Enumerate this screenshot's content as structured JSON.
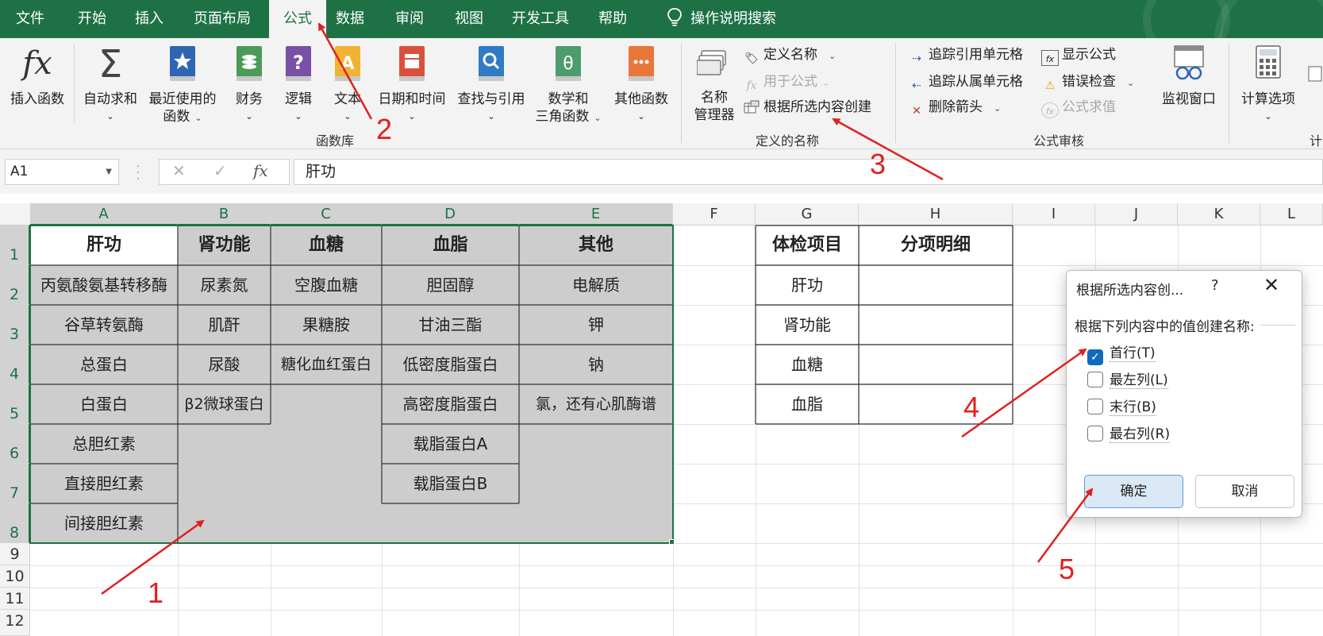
{
  "tabs": [
    "文件",
    "开始",
    "插入",
    "页面布局",
    "公式",
    "数据",
    "审阅",
    "视图",
    "开发工具",
    "帮助"
  ],
  "active_tab": "公式",
  "tell_me": "操作说明搜索",
  "ribbon": {
    "function_library": {
      "label": "函数库",
      "insert_function": "插入函数",
      "autosum": "自动求和",
      "recent_line1": "最近使用的",
      "recent_line2": "函数",
      "financial": "财务",
      "logical": "逻辑",
      "text": "文本",
      "datetime": "日期和时间",
      "lookup": "查找与引用",
      "math_line1": "数学和",
      "math_line2": "三角函数",
      "more": "其他函数"
    },
    "defined_names": {
      "label": "定义的名称",
      "manager_line1": "名称",
      "manager_line2": "管理器",
      "define_name": "定义名称",
      "use_in_formula": "用于公式",
      "create_from_selection": "根据所选内容创建"
    },
    "formula_auditing": {
      "label": "公式审核",
      "trace_precedents": "追踪引用单元格",
      "trace_dependents": "追踪从属单元格",
      "remove_arrows": "删除箭头",
      "show_formulas": "显示公式",
      "error_checking": "错误检查",
      "evaluate_formula": "公式求值",
      "watch_window": "监视窗口"
    },
    "calculation": {
      "options": "计算选项",
      "label_partial": "计"
    }
  },
  "formula_bar": {
    "name_box": "A1",
    "fx": "fx",
    "value": "肝功"
  },
  "columns": [
    "A",
    "B",
    "C",
    "D",
    "E",
    "F",
    "G",
    "H",
    "I",
    "J",
    "K",
    "L"
  ],
  "rows": [
    "1",
    "2",
    "3",
    "4",
    "5",
    "6",
    "7",
    "8",
    "9",
    "10",
    "11",
    "12"
  ],
  "table_main": {
    "headers": [
      "肝功",
      "肾功能",
      "血糖",
      "血脂",
      "其他"
    ],
    "col_A": [
      "丙氨酸氨基转移酶",
      "谷草转氨酶",
      "总蛋白",
      "白蛋白",
      "总胆红素",
      "直接胆红素",
      "间接胆红素"
    ],
    "col_B": [
      "尿素氮",
      "肌酐",
      "尿酸",
      "β2微球蛋白"
    ],
    "col_C": [
      "空腹血糖",
      "果糖胺",
      "糖化血红蛋白"
    ],
    "col_D": [
      "胆固醇",
      "甘油三酯",
      "低密度脂蛋白",
      "高密度脂蛋白",
      "载脂蛋白A",
      "载脂蛋白B"
    ],
    "col_E": [
      "电解质",
      "钾",
      "钠",
      "氯，还有心肌酶谱"
    ]
  },
  "table_side": {
    "header_g": "体检项目",
    "header_h": "分项明细",
    "items": [
      "肝功",
      "肾功能",
      "血糖",
      "血脂"
    ]
  },
  "dialog": {
    "title": "根据所选内容创...",
    "help": "?",
    "description": "根据下列内容中的值创建名称:",
    "options": [
      {
        "label": "首行(T)",
        "checked": true
      },
      {
        "label": "最左列(L)",
        "checked": false
      },
      {
        "label": "末行(B)",
        "checked": false
      },
      {
        "label": "最右列(R)",
        "checked": false
      }
    ],
    "ok": "确定",
    "cancel": "取消"
  },
  "annotations": [
    "1",
    "2",
    "3",
    "4",
    "5"
  ],
  "colors": {
    "excel_green": "#1e7145",
    "annotation_red": "#e02020",
    "checkbox_blue": "#0f6cbd"
  }
}
